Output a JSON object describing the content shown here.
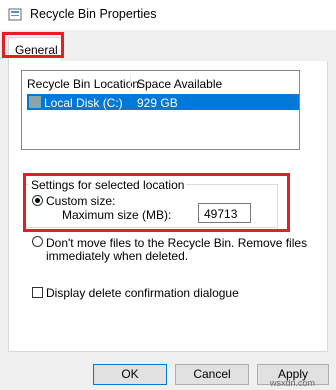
{
  "window": {
    "title": "Recycle Bin Properties",
    "icon": "recycle-bin-icon"
  },
  "tabs": [
    {
      "label": "General",
      "selected": true
    }
  ],
  "list": {
    "columns": [
      "Recycle Bin Location",
      "Space Available"
    ],
    "rows": [
      {
        "location": "Local Disk (C:)",
        "space": "929 GB",
        "selected": true,
        "icon": "drive-icon"
      }
    ]
  },
  "settings": {
    "group_label": "Settings for selected location",
    "custom_size_label": "Custom size:",
    "custom_size_selected": true,
    "max_size_label": "Maximum size (MB):",
    "max_size_value": "49713",
    "dont_move_line1": "Don't move files to the Recycle Bin. Remove files",
    "dont_move_line2": "immediately when deleted.",
    "dont_move_selected": false,
    "confirm_label": "Display delete confirmation dialogue",
    "confirm_checked": false
  },
  "buttons": {
    "ok": "OK",
    "cancel": "Cancel",
    "apply": "Apply"
  },
  "watermark": "wsxdn.com",
  "colors": {
    "highlight": "#e31e24",
    "selection": "#0078d7"
  }
}
